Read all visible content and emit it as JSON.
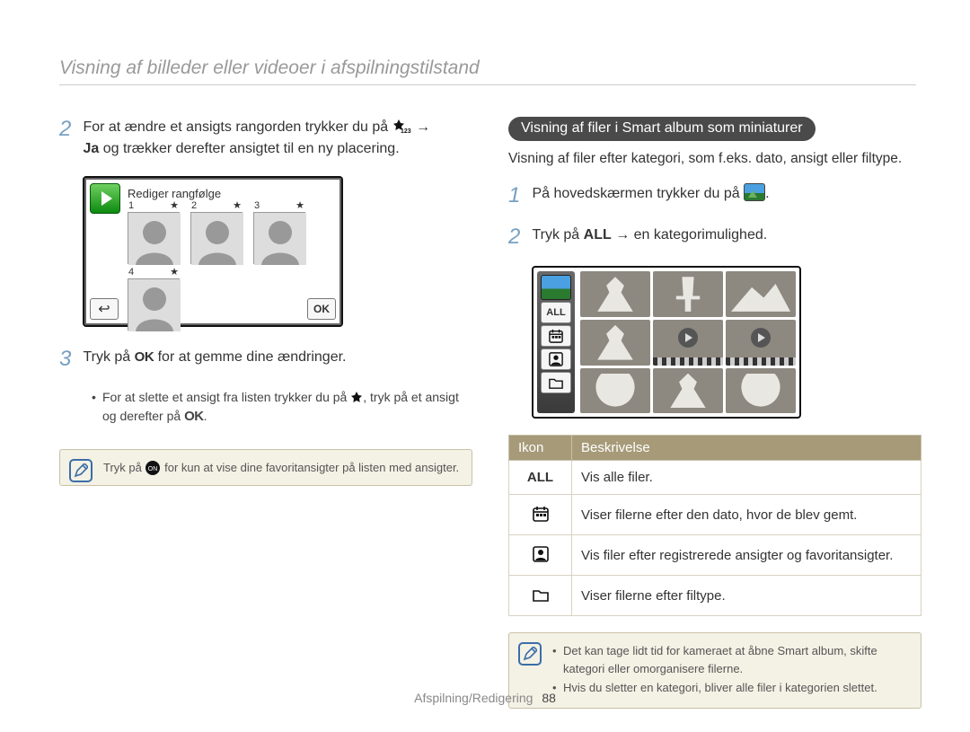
{
  "header": {
    "title": "Visning af billeder eller videoer i afspilningstilstand"
  },
  "left": {
    "step2_a": "For at ændre et ansigts rangorden trykker du på ",
    "step2_arrow": " → ",
    "step2_b": " og trækker derefter ansigtet til en ny placering.",
    "step2_ja": "Ja",
    "screen_title": "Rediger rangfølge",
    "face_nums": [
      "1",
      "2",
      "3",
      "4"
    ],
    "ok_label": "OK",
    "step3_a": "Tryk på ",
    "step3_b": " for at gemme dine ændringer.",
    "bullet_a": "For at slette et ansigt fra listen trykker du på ",
    "bullet_b": ", tryk på et ansigt og derefter på ",
    "bullet_c": ".",
    "note_a": "Tryk på ",
    "note_b": " for kun at vise dine favoritansigter på listen med ansigter."
  },
  "right": {
    "pill": "Visning af filer i Smart album som miniaturer",
    "desc": "Visning af filer efter kategori, som f.eks. dato, ansigt eller filtype.",
    "step1_a": "På hovedskærmen trykker du på ",
    "step1_b": ".",
    "step2_a": "Tryk på ",
    "step2_all": "ALL",
    "step2_b": " → en kategorimulighed.",
    "sidebar_all": "ALL",
    "table": {
      "head_icon": "Ikon",
      "head_desc": "Beskrivelse",
      "rows": [
        {
          "icon": "ALL",
          "text": "Vis alle filer."
        },
        {
          "icon": "calendar",
          "text": "Viser filerne efter den dato, hvor de blev gemt."
        },
        {
          "icon": "face",
          "text": "Vis filer efter registrerede ansigter og favoritansigter."
        },
        {
          "icon": "folder",
          "text": "Viser filerne efter filtype."
        }
      ]
    },
    "note_items": [
      "Det kan tage lidt tid for kameraet at åbne Smart album, skifte kategori eller omorganisere filerne.",
      "Hvis du sletter en kategori, bliver alle filer i kategorien slettet."
    ]
  },
  "footer": {
    "section": "Afspilning/Redigering",
    "page": "88"
  }
}
